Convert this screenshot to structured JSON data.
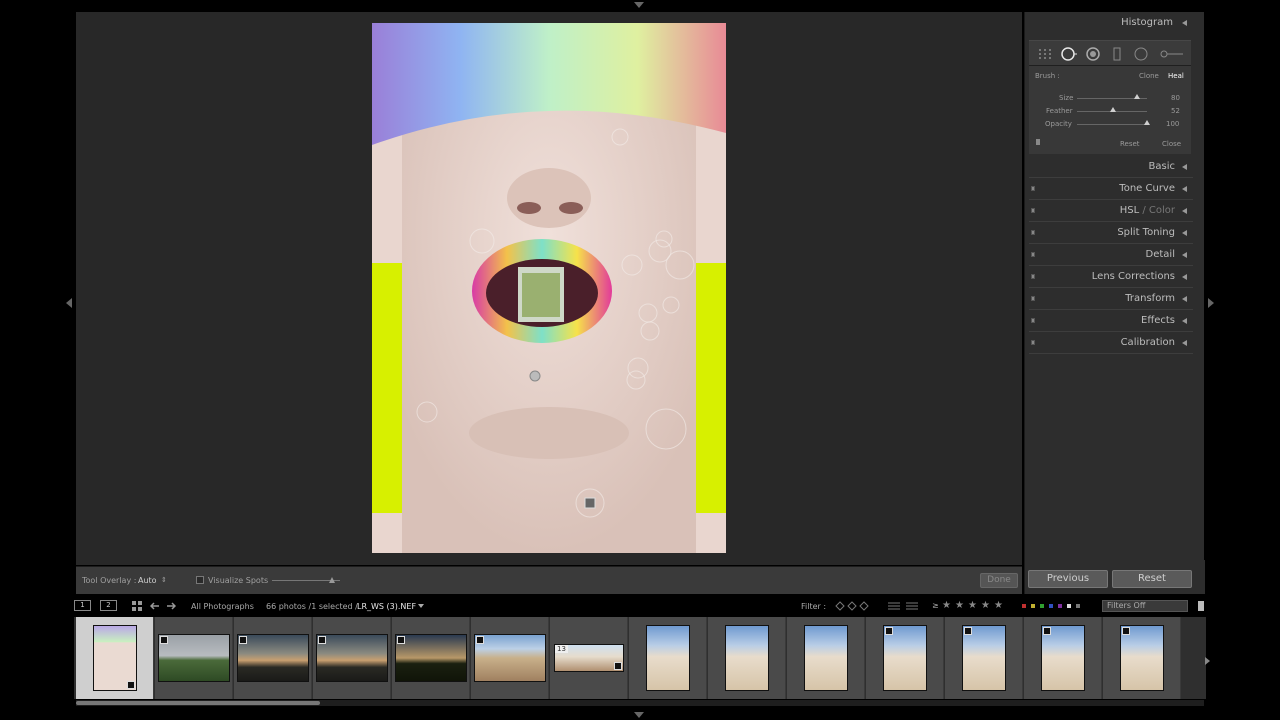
{
  "panels": {
    "histogram_label": "Histogram",
    "spot": {
      "brush_label": "Brush :",
      "clone_label": "Clone",
      "heal_label": "Heal",
      "size_label": "Size",
      "size_value": "80",
      "feather_label": "Feather",
      "feather_value": "52",
      "opacity_label": "Opacity",
      "opacity_value": "100",
      "reset_label": "Reset",
      "close_label": "Close",
      "size_level": 0.85,
      "feather_level": 0.52,
      "opacity_level": 1.0
    },
    "sections": [
      {
        "label": "Basic",
        "has_switch": false
      },
      {
        "label": "Tone Curve",
        "has_switch": true
      },
      {
        "label": "HSL",
        "label_dim": " / Color",
        "has_switch": true
      },
      {
        "label": "Split Toning",
        "has_switch": true
      },
      {
        "label": "Detail",
        "has_switch": true
      },
      {
        "label": "Lens Corrections",
        "has_switch": true
      },
      {
        "label": "Transform",
        "has_switch": true
      },
      {
        "label": "Effects",
        "has_switch": true
      },
      {
        "label": "Calibration",
        "has_switch": true
      }
    ],
    "previous_label": "Previous",
    "reset_label": "Reset"
  },
  "toolbar": {
    "overlay_label": "Tool Overlay :",
    "overlay_value": "Auto",
    "overlay_chevron": "⇕",
    "visualize_label": "Visualize Spots",
    "done_label": "Done"
  },
  "filmstrip_header": {
    "page1": "1",
    "page2": "2",
    "source": "All Photographs",
    "count": "66 photos /1 selected /",
    "filename": "LR_WS (3).NEF",
    "filter_label": "Filter :",
    "rating_symbol": "≥",
    "filters_off": "Filters Off"
  },
  "filmstrip": {
    "badge_number": "13",
    "thumbnails": [
      {
        "kind": "portrait",
        "selected": true
      },
      {
        "kind": "landscape-green"
      },
      {
        "kind": "sunset"
      },
      {
        "kind": "sunset"
      },
      {
        "kind": "sunset-dark"
      },
      {
        "kind": "desert-wide"
      },
      {
        "kind": "desert-small"
      },
      {
        "kind": "desert-tall"
      },
      {
        "kind": "desert-tall"
      },
      {
        "kind": "desert-tall"
      },
      {
        "kind": "desert-tall"
      },
      {
        "kind": "desert-tall"
      },
      {
        "kind": "desert-tall"
      },
      {
        "kind": "desert-tall"
      }
    ]
  },
  "colors": {
    "panel_bg": "#2d2d2d",
    "workspace_bg": "#282828",
    "selected_cell": "#cfcfcf",
    "background_yellow": "#d7f000",
    "skin": "#e9d6cf"
  }
}
